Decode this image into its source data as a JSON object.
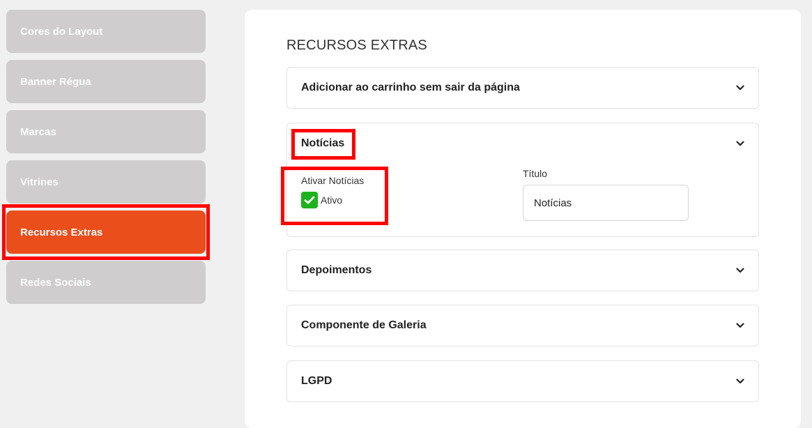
{
  "sidebar": {
    "items": [
      {
        "label": "Cores do Layout"
      },
      {
        "label": "Banner Régua"
      },
      {
        "label": "Marcas"
      },
      {
        "label": "Vitrines"
      },
      {
        "label": "Recursos Extras"
      },
      {
        "label": "Redes Sociais"
      }
    ],
    "active_index": 4
  },
  "main": {
    "title": "RECURSOS EXTRAS",
    "accordions": {
      "carrinho": {
        "label": "Adicionar ao carrinho sem sair da página"
      },
      "noticias": {
        "label": "Notícias",
        "ativar_label": "Ativar Notícias",
        "ativo_label": "Ativo",
        "checked": true,
        "titulo_label": "Título",
        "titulo_value": "Notícias"
      },
      "depoimentos": {
        "label": "Depoimentos"
      },
      "galeria": {
        "label": "Componente de Galeria"
      },
      "lgpd": {
        "label": "LGPD"
      }
    }
  },
  "colors": {
    "accent": "#e94e1b",
    "sidebar_inactive": "#cfcdcd",
    "checkbox": "#1fb21f",
    "highlight": "#ff0000"
  }
}
